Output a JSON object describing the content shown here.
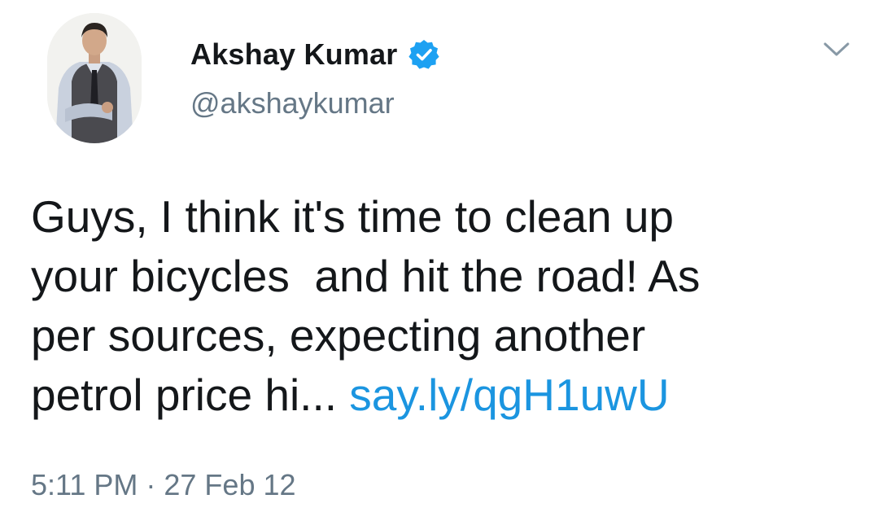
{
  "tweet": {
    "author": {
      "display_name": "Akshay Kumar",
      "handle": "@akshaykumar",
      "verified": true,
      "avatar_icon": "profile-photo"
    },
    "text_lines": [
      "Guys, I think it's time to clean up",
      "your bicycles  and hit the road! As",
      "per sources, expecting another",
      "petrol price hi... "
    ],
    "link_text": "say.ly/qgH1uwU",
    "timestamp": "5:11 PM · 27 Feb 12",
    "menu_icon": "chevron-down-icon"
  },
  "colors": {
    "text": "#14171a",
    "secondary": "#657786",
    "link": "#1b95e0",
    "verified_badge": "#1da1f2"
  }
}
